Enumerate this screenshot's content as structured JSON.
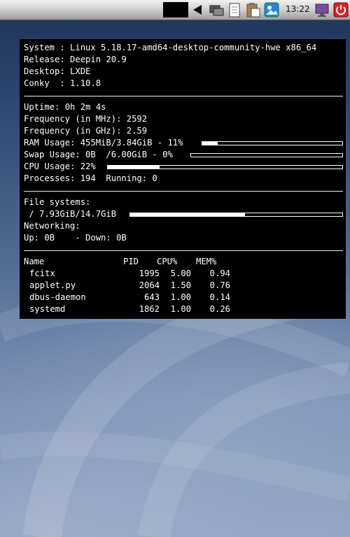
{
  "taskbar": {
    "icons": [
      "black-window-button",
      "arrow-left-icon",
      "network-icon",
      "document-icon",
      "clipboard-icon",
      "image-viewer-icon",
      "display-icon",
      "power-icon"
    ],
    "clock": "13:22"
  },
  "conky": {
    "system_line": "System : Linux 5.18.17-amd64-desktop-community-hwe x86_64",
    "release_line": "Release: Deepin 20.9",
    "desktop_line": "Desktop: LXDE",
    "conky_line": "Conky  : 1.10.8",
    "uptime_line": "Uptime: 0h 2m 4s",
    "freq_mhz_line": "Frequency (in MHz): 2592",
    "freq_ghz_line": "Frequency (in GHz): 2.59",
    "ram_line": "RAM Usage: 455MiB/3.84GiB - 11%",
    "ram_fraction": 0.11,
    "swap_line": "Swap Usage: 0B  /6.00GiB - 0%",
    "swap_fraction": 0.0,
    "cpu_line": "CPU Usage: 22%",
    "cpu_fraction": 0.22,
    "processes_line": "Processes: 194  Running: 0",
    "fs_title": "File systems:",
    "fs_line": " / 7.93GiB/14.7GiB",
    "fs_fraction": 0.54,
    "net_title": "Networking:",
    "net_line": "Up: 0B    - Down: 0B",
    "proc_headers": [
      "Name",
      "PID",
      "CPU%",
      "MEM%"
    ],
    "processes": [
      {
        "name": "fcitx",
        "pid": "1995",
        "cpu": "5.00",
        "mem": "0.94"
      },
      {
        "name": "applet.py",
        "pid": "2064",
        "cpu": "1.50",
        "mem": "0.76"
      },
      {
        "name": "dbus-daemon",
        "pid": "643",
        "cpu": "1.00",
        "mem": "0.14"
      },
      {
        "name": "systemd",
        "pid": "1862",
        "cpu": "1.00",
        "mem": "0.26"
      }
    ]
  }
}
